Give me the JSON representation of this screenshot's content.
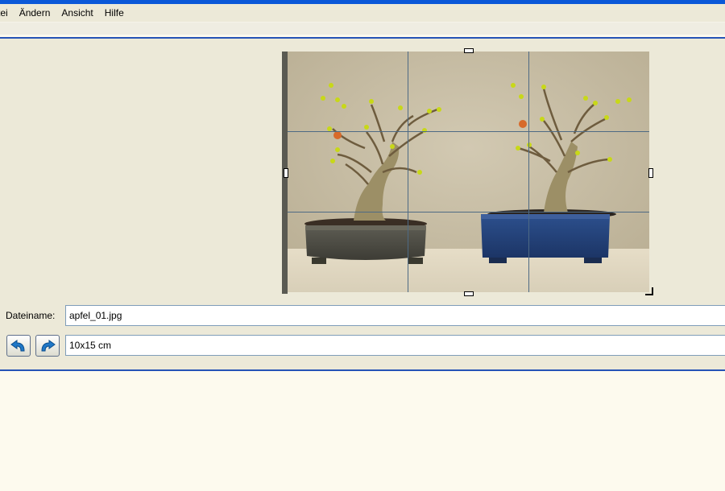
{
  "menu": {
    "items": [
      "tei",
      "Ändern",
      "Ansicht",
      "Hilfe"
    ]
  },
  "preview": {
    "icons": {
      "rotate_left": "rotate-left-icon",
      "rotate_right": "rotate-right-icon"
    }
  },
  "form": {
    "filename_label": "Dateiname:",
    "filename_value": "apfel_01.jpg",
    "format_value": "10x15 cm"
  },
  "colors": {
    "accent": "#2654b6",
    "panel": "#ece9d8",
    "page": "#fdfaee",
    "grid": "#4e6a84"
  }
}
